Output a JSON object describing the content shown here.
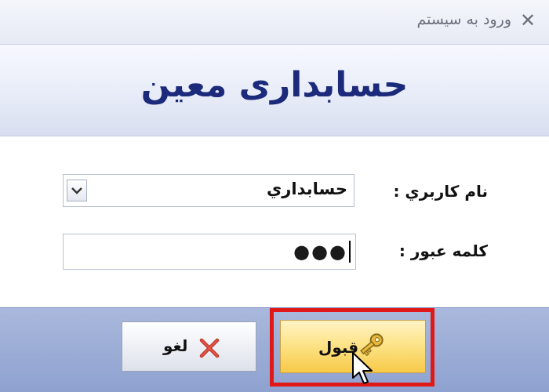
{
  "window": {
    "title": "ورود به سيستم",
    "close_symbol": "✕"
  },
  "banner": {
    "title": "حسابداری معین"
  },
  "form": {
    "username_label": "نام کاربري :",
    "username_value": "حسابداري",
    "password_label": "کلمه عبور :",
    "password_value": "●●●"
  },
  "buttons": {
    "cancel_label": "لغو",
    "ok_label": "قبول"
  },
  "icons": {
    "close": "close-icon",
    "dropdown": "chevron-down-icon",
    "cancel": "x-icon",
    "ok": "key-icon",
    "cursor": "mouse-pointer-icon"
  },
  "colors": {
    "banner_text": "#1b2a7a",
    "highlight": "#e01818",
    "ok_button": "#fde48a",
    "bottom_panel": "#9aaad3"
  }
}
